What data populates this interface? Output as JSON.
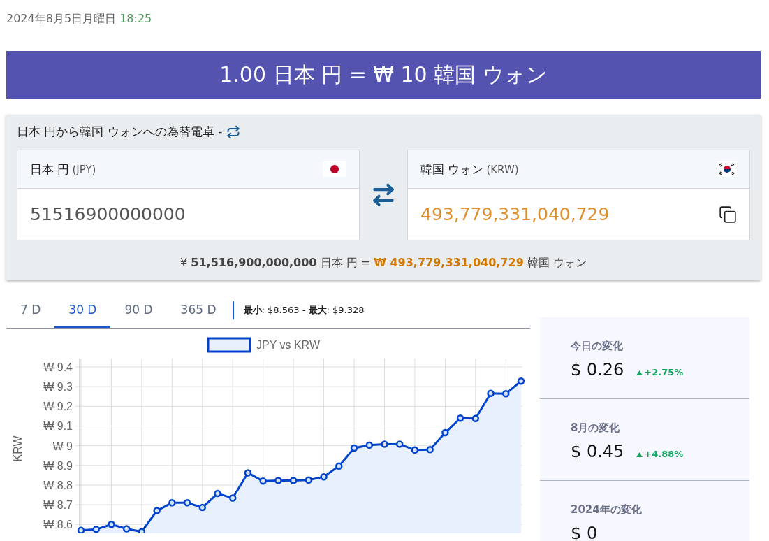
{
  "datetime": {
    "date": "2024年8月5日月曜日",
    "time": "18:25"
  },
  "headline": "1.00 日本 円 = ₩ 10 韓国 ウォン",
  "converter": {
    "title": "日本 円から韓国 ウォンへの為替電卓 -",
    "from": {
      "name": "日本 円",
      "code": "(JPY)",
      "kind": "jp",
      "value": "51516900000000"
    },
    "to": {
      "name": "韓国 ウォン",
      "code": "(KRW)",
      "kind": "kr",
      "value": "493,779,331,040,729"
    },
    "result": "¥ **51,516,900,000,000** 日本 円 = ",
    "result_amount": "₩ 493,779,331,040,729",
    "result_unit": " 韓国 ウォン"
  },
  "range_tabs": [
    {
      "label": "7 D",
      "selected": false
    },
    {
      "label": "30 D",
      "selected": true
    },
    {
      "label": "90 D",
      "selected": false
    },
    {
      "label": "365 D",
      "selected": false
    }
  ],
  "range_summary": "**最小**: $8.563 - **最大**: $9.328",
  "chart": {
    "chart_data": {
      "type": "area",
      "grid": true,
      "ylabel": "KRW",
      "ylim": [
        8.555,
        9.4
      ],
      "yticks": [
        {
          "value": 8.6,
          "label": "₩ 8.6"
        },
        {
          "value": 8.7,
          "label": "₩ 8.7"
        },
        {
          "value": 8.8,
          "label": "₩ 8.8"
        },
        {
          "value": 8.9,
          "label": "₩ 8.9"
        },
        {
          "value": 9,
          "label": "₩ 9"
        },
        {
          "value": 9.1,
          "label": "₩ 9.1"
        },
        {
          "value": 9.2,
          "label": "₩ 9.2"
        },
        {
          "value": 9.3,
          "label": "₩ 9.3"
        },
        {
          "value": 9.4,
          "label": "₩ 9.4"
        }
      ],
      "series": [
        {
          "name": "JPY vs KRW",
          "color": "#0044cc",
          "values": [
            8.57,
            8.575,
            8.6,
            8.578,
            8.563,
            8.67,
            8.71,
            8.71,
            8.686,
            8.757,
            8.734,
            8.862,
            8.82,
            8.823,
            8.823,
            8.826,
            8.842,
            8.897,
            8.988,
            9.003,
            9.008,
            9.008,
            8.978,
            8.98,
            9.066,
            9.14,
            9.138,
            9.266,
            9.264,
            9.328
          ]
        }
      ]
    }
  },
  "changes": [
    {
      "label": "今日の変化",
      "value": "$ 0.26",
      "delta": "+2.75%"
    },
    {
      "label": "8月の変化",
      "value": "$ 0.45",
      "delta": "+4.88%"
    },
    {
      "label": "2024年の変化",
      "value": "$ 0"
    }
  ]
}
